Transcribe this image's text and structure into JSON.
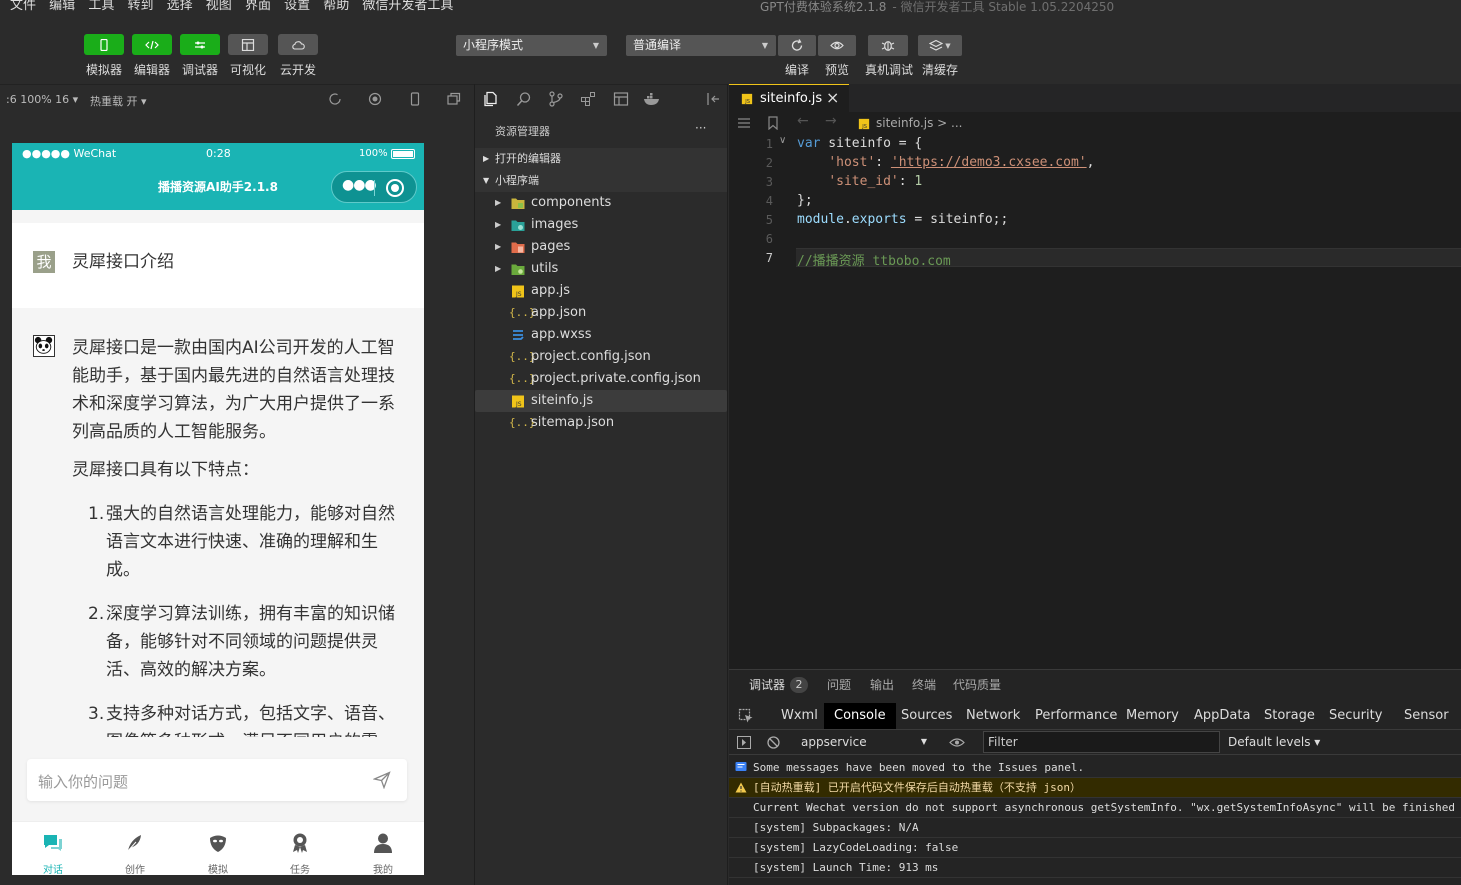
{
  "menubar": {
    "items": [
      "文件",
      "编辑",
      "工具",
      "转到",
      "选择",
      "视图",
      "界面",
      "设置",
      "帮助",
      "微信开发者工具"
    ],
    "title": "GPT付费体验系统2.1.8",
    "subtitle": "- 微信开发者工具 Stable 1.05.2204250"
  },
  "toolbar": {
    "buttons": [
      {
        "label": "模拟器",
        "icon": "phone-icon",
        "color": "#1aad19"
      },
      {
        "label": "编辑器",
        "icon": "code-icon",
        "color": "#1aad19"
      },
      {
        "label": "调试器",
        "icon": "debug-icon",
        "color": "#1aad19"
      },
      {
        "label": "可视化",
        "icon": "layout-icon",
        "color": "#555555"
      },
      {
        "label": "云开发",
        "icon": "cloud-icon",
        "color": "#555555"
      }
    ],
    "mode_select": "小程序模式",
    "compile_select": "普通编译",
    "actions": [
      {
        "label": "编译",
        "icon": "refresh-icon"
      },
      {
        "label": "预览",
        "icon": "eye-icon"
      },
      {
        "label": "真机调试",
        "icon": "bug-icon"
      },
      {
        "label": "清缓存",
        "icon": "layers-icon"
      }
    ]
  },
  "simulator_bar": {
    "device": ":6 100% 16 ▾",
    "hot_reload": "热重载 开 ▾"
  },
  "phone": {
    "status_carrier": "●●●●● WeChat",
    "status_time": "0:28",
    "status_battery": "100%",
    "nav_title": "播播资源AI助手2.1.8",
    "user_avatar_text": "我",
    "user_message": "灵犀接口介绍",
    "ai_paragraph_1": "灵犀接口是一款由国内AI公司开发的人工智能助手，基于国内最先进的自然语言处理技术和深度学习算法，为广大用户提供了一系列高品质的人工智能服务。",
    "ai_paragraph_2": "灵犀接口具有以下特点：",
    "ai_list": [
      {
        "num": "1.",
        "text": "强大的自然语言处理能力，能够对自然语言文本进行快速、准确的理解和生成。"
      },
      {
        "num": "2.",
        "text": "深度学习算法训练，拥有丰富的知识储备，能够针对不同领域的问题提供灵活、高效的解决方案。"
      },
      {
        "num": "3.",
        "text": "支持多种对话方式，包括文字、语音、图像等多种形式，满足不同用户的需"
      }
    ],
    "input_placeholder": "输入你的问题",
    "tabs": [
      {
        "label": "对话",
        "icon": "chat-icon",
        "active": true
      },
      {
        "label": "创作",
        "icon": "feather-icon",
        "active": false
      },
      {
        "label": "模拟",
        "icon": "mask-icon",
        "active": false
      },
      {
        "label": "任务",
        "icon": "award-icon",
        "active": false
      },
      {
        "label": "我的",
        "icon": "user-icon",
        "active": false
      }
    ],
    "accent": "#1ab4b4"
  },
  "explorer": {
    "title": "资源管理器",
    "more": "···",
    "open_editors": "打开的编辑器",
    "project_root": "小程序端",
    "items": [
      {
        "name": "components",
        "type": "folder",
        "icon": "folder-icon",
        "color": "#c9b53c"
      },
      {
        "name": "images",
        "type": "folder",
        "icon": "folder-image-icon",
        "color": "#2aa198"
      },
      {
        "name": "pages",
        "type": "folder",
        "icon": "folder-pages-icon",
        "color": "#e06c4b"
      },
      {
        "name": "utils",
        "type": "folder",
        "icon": "folder-utils-icon",
        "color": "#6aaa3c"
      },
      {
        "name": "app.js",
        "type": "js",
        "icon": "js-file-icon"
      },
      {
        "name": "app.json",
        "type": "json",
        "icon": "json-file-icon"
      },
      {
        "name": "app.wxss",
        "type": "css",
        "icon": "css-file-icon"
      },
      {
        "name": "project.config.json",
        "type": "json",
        "icon": "json-file-icon"
      },
      {
        "name": "project.private.config.json",
        "type": "json",
        "icon": "json-file-icon"
      },
      {
        "name": "siteinfo.js",
        "type": "js",
        "icon": "js-file-icon",
        "selected": true
      },
      {
        "name": "sitemap.json",
        "type": "json",
        "icon": "json-file-icon"
      }
    ]
  },
  "editor": {
    "tab": "siteinfo.js",
    "breadcrumb": "siteinfo.js > ...",
    "lines": [
      {
        "n": "1",
        "kw": "var",
        "rest": " siteinfo = {"
      },
      {
        "n": "2",
        "indent": "    ",
        "key": "'host'",
        "sep": ": ",
        "val": "'https://demo3.cxsee.com'",
        "tail": ","
      },
      {
        "n": "3",
        "indent": "    ",
        "key": "'site_id'",
        "sep": ": ",
        "num": "1"
      },
      {
        "n": "4",
        "rest": "};"
      },
      {
        "n": "5",
        "mod": "module",
        "dot": ".",
        "exp": "exports",
        "rest": " = siteinfo;;"
      },
      {
        "n": "6",
        "rest": ""
      },
      {
        "n": "7",
        "comment": "//播播资源 ttbobo.com"
      }
    ]
  },
  "devtools": {
    "top_tabs": [
      "调试器",
      "问题",
      "输出",
      "终端",
      "代码质量"
    ],
    "badge": "2",
    "panel_tabs": [
      "Wxml",
      "Console",
      "Sources",
      "Network",
      "Performance",
      "Memory",
      "AppData",
      "Storage",
      "Security",
      "Sensor"
    ],
    "context": "appservice",
    "filter_placeholder": "Filter",
    "levels": "Default levels ▾",
    "logs": [
      {
        "text": "Some messages have been moved to the Issues panel.",
        "type": "info"
      },
      {
        "text": "[自动热重载] 已开启代码文件保存后自动热重载（不支持 json）",
        "type": "warn"
      },
      {
        "text": "Current Wechat version do not support asynchronous getSystemInfo. \"wx.getSystemInfoAsync\" will be finished",
        "type": "log"
      },
      {
        "text": "[system] Subpackages: N/A",
        "type": "log"
      },
      {
        "text": "[system] LazyCodeLoading: false",
        "type": "log"
      },
      {
        "text": "[system] Launch Time: 913 ms",
        "type": "log"
      }
    ]
  }
}
